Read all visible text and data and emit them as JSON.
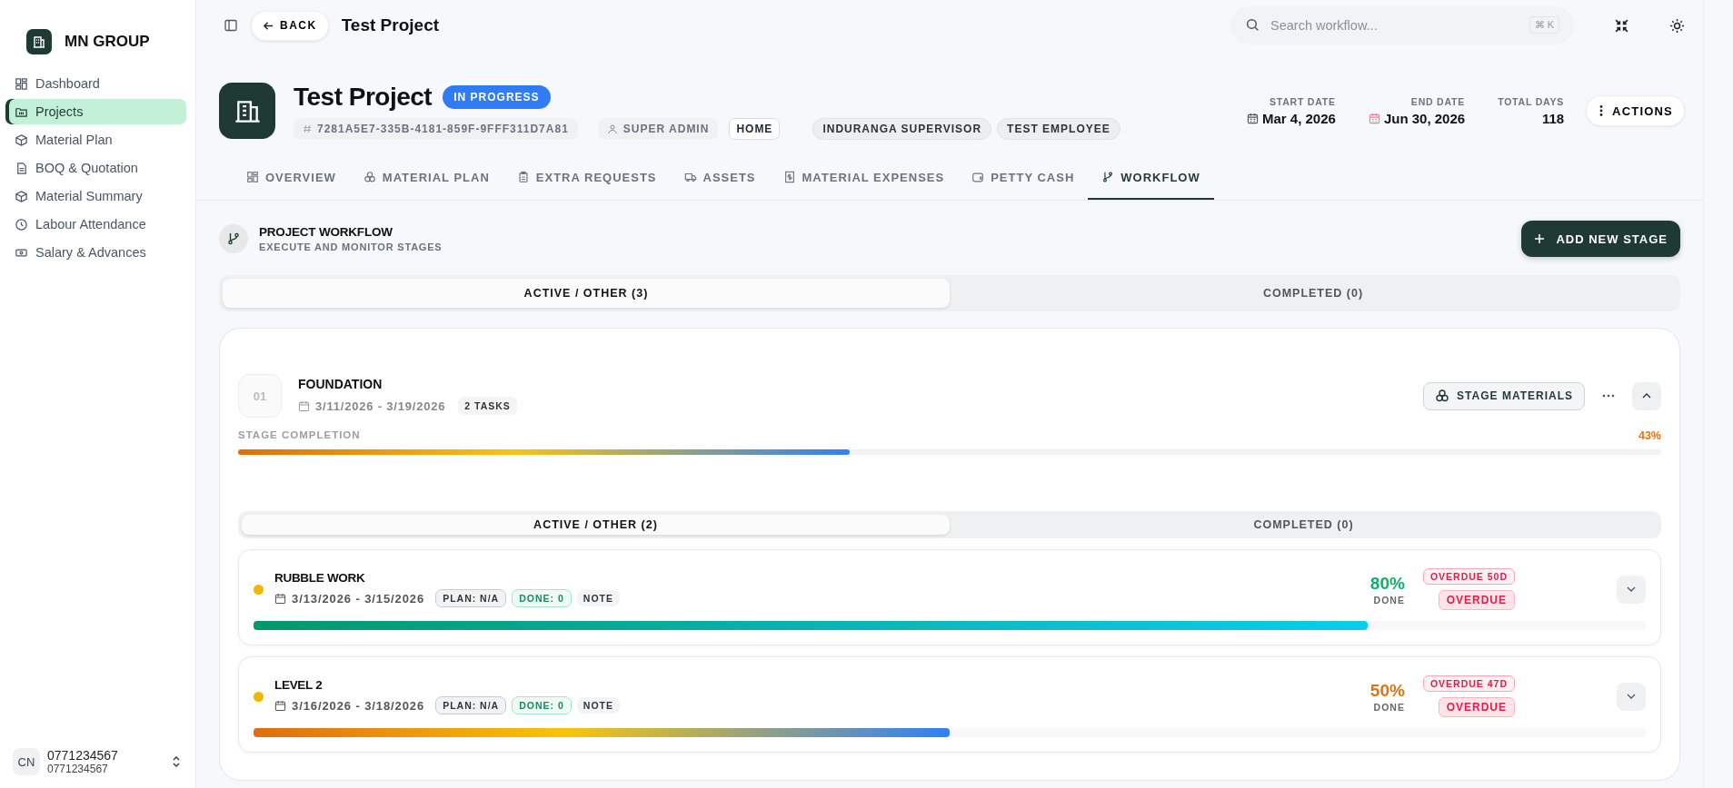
{
  "sidebar": {
    "brand": "MN GROUP",
    "items": [
      {
        "label": "Dashboard",
        "selected": false
      },
      {
        "label": "Projects",
        "selected": true
      },
      {
        "label": "Material Plan",
        "selected": false
      },
      {
        "label": "BOQ & Quotation",
        "selected": false
      },
      {
        "label": "Material Summary",
        "selected": false
      },
      {
        "label": "Labour Attendance",
        "selected": false
      },
      {
        "label": "Salary & Advances",
        "selected": false
      }
    ],
    "user": {
      "initials": "CN",
      "name": "0771234567",
      "sub": "0771234567"
    }
  },
  "topbar": {
    "back": "BACK",
    "title": "Test Project",
    "search": {
      "placeholder": "Search workflow...",
      "shortcut": "⌘ K"
    }
  },
  "project": {
    "name": "Test Project",
    "status": "IN PROGRESS",
    "id": "7281A5E7-335B-4181-859F-9FFF311D7A81",
    "role": "SUPER ADMIN",
    "type": "HOME",
    "people": [
      "INDURANGA SUPERVISOR",
      "TEST EMPLOYEE"
    ],
    "dates": [
      {
        "label": "START DATE",
        "value": "Mar 4, 2026",
        "kind": "start"
      },
      {
        "label": "END DATE",
        "value": "Jun 30, 2026",
        "kind": "end"
      },
      {
        "label": "TOTAL DAYS",
        "value": "118",
        "kind": "count"
      }
    ],
    "actions": "ACTIONS"
  },
  "tabs": [
    {
      "label": "OVERVIEW",
      "selected": false
    },
    {
      "label": "MATERIAL PLAN",
      "selected": false
    },
    {
      "label": "EXTRA REQUESTS",
      "selected": false
    },
    {
      "label": "ASSETS",
      "selected": false
    },
    {
      "label": "MATERIAL EXPENSES",
      "selected": false
    },
    {
      "label": "PETTY CASH",
      "selected": false
    },
    {
      "label": "WORKFLOW",
      "selected": true
    }
  ],
  "workflow": {
    "title": "PROJECT WORKFLOW",
    "subtitle": "EXECUTE AND MONITOR STAGES",
    "add": "ADD NEW STAGE",
    "filters": [
      {
        "label": "ACTIVE / OTHER (3)",
        "selected": true
      },
      {
        "label": "COMPLETED (0)",
        "selected": false
      }
    ],
    "stage": {
      "number": "01",
      "name": "FOUNDATION",
      "dates": "3/11/2026 - 3/19/2026",
      "tasks": "2 TASKS",
      "materials": "STAGE MATERIALS",
      "expanded": true,
      "completion_label": "STAGE COMPLETION",
      "percent": "43%",
      "level": 0.43,
      "filters": [
        {
          "label": "ACTIVE / OTHER (2)",
          "selected": true
        },
        {
          "label": "COMPLETED (0)",
          "selected": false
        }
      ],
      "items": [
        {
          "name": "RUBBLE WORK",
          "color": "#f5b400",
          "dates": "3/13/2026 - 3/15/2026",
          "plan": "PLAN: N/A",
          "done": "DONE: 0",
          "note": "NOTE",
          "percent": "80%",
          "done_label": "DONE",
          "overdue_days": "OVERDUE 50D",
          "status": "OVERDUE",
          "level": 0.8
        },
        {
          "name": "LEVEL 2",
          "color": "#f5b400",
          "dates": "3/16/2026 - 3/18/2026",
          "plan": "PLAN: N/A",
          "done": "DONE: 0",
          "note": "NOTE",
          "percent": "50%",
          "done_label": "DONE",
          "overdue_days": "OVERDUE 47D",
          "status": "OVERDUE",
          "level": 0.5
        }
      ]
    }
  }
}
